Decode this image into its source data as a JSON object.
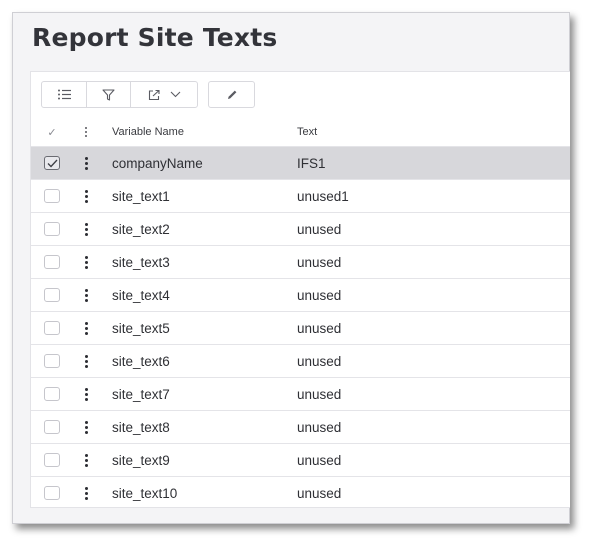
{
  "page": {
    "title": "Report Site Texts"
  },
  "toolbar": {
    "icons": [
      "list-settings-icon",
      "filter-icon",
      "export-icon",
      "chevron-down-icon",
      "edit-pencil-icon"
    ]
  },
  "table": {
    "header_check": "✓",
    "columns": [
      "Variable Name",
      "Text"
    ],
    "rows": [
      {
        "variable": "companyName",
        "text": "IFS1",
        "selected": true
      },
      {
        "variable": "site_text1",
        "text": "unused1",
        "selected": false
      },
      {
        "variable": "site_text2",
        "text": "unused",
        "selected": false
      },
      {
        "variable": "site_text3",
        "text": "unused",
        "selected": false
      },
      {
        "variable": "site_text4",
        "text": "unused",
        "selected": false
      },
      {
        "variable": "site_text5",
        "text": "unused",
        "selected": false
      },
      {
        "variable": "site_text6",
        "text": "unused",
        "selected": false
      },
      {
        "variable": "site_text7",
        "text": "unused",
        "selected": false
      },
      {
        "variable": "site_text8",
        "text": "unused",
        "selected": false
      },
      {
        "variable": "site_text9",
        "text": "unused",
        "selected": false
      },
      {
        "variable": "site_text10",
        "text": "unused",
        "selected": false
      }
    ]
  },
  "colors": {
    "selected_row": "#d7d7db",
    "title": "#33343a",
    "border": "#e4e4e8"
  }
}
